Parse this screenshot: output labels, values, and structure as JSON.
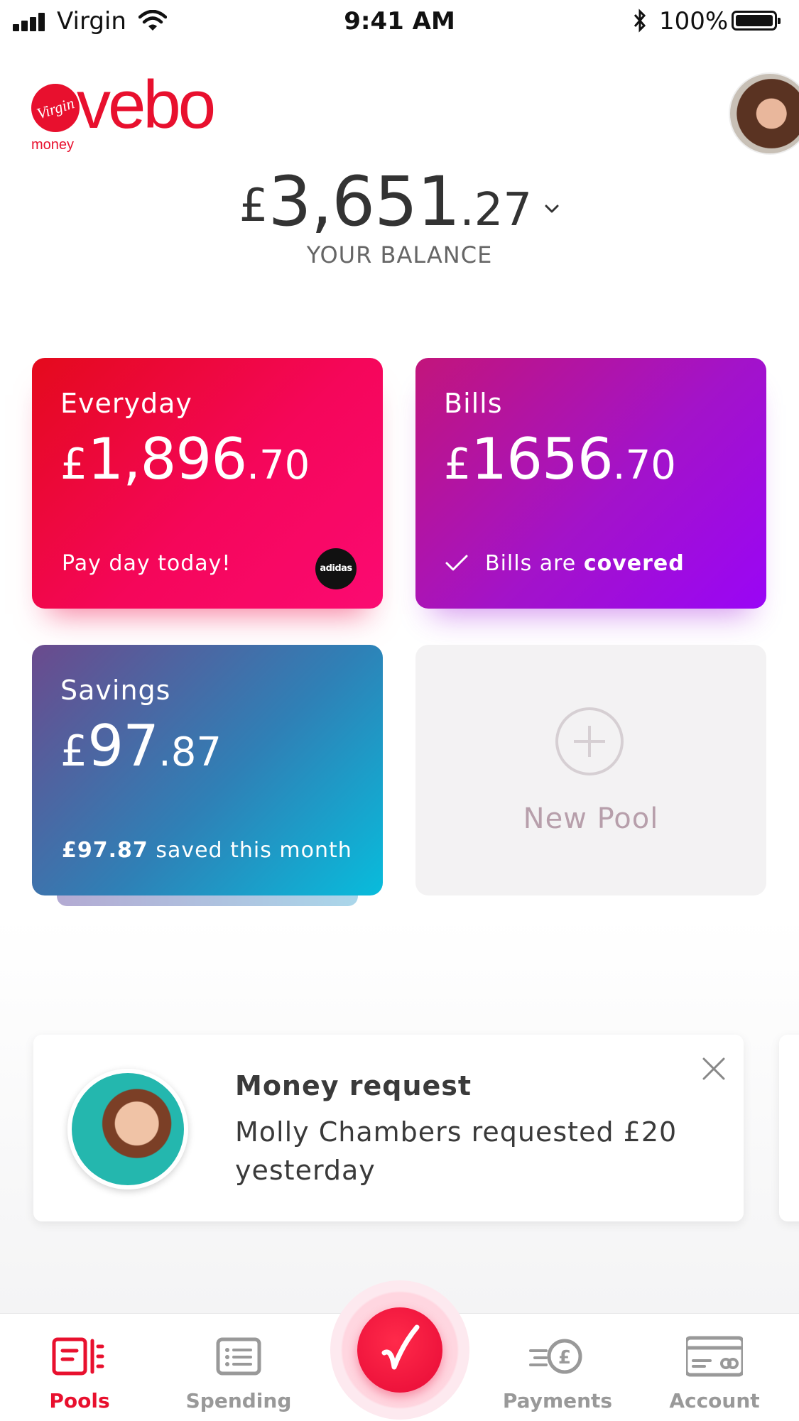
{
  "status_bar": {
    "carrier": "Virgin",
    "time": "9:41 AM",
    "battery": "100%"
  },
  "brand": {
    "badge": "Virgin",
    "name": "vebo",
    "sub": "money",
    "color": "#e8102e"
  },
  "balance": {
    "currency": "£",
    "main": "3,651",
    "pence": ".27",
    "label": "YOUR BALANCE"
  },
  "cards": {
    "everyday": {
      "title": "Everyday",
      "currency": "£",
      "main": "1,896",
      "pence": ".70",
      "footer": "Pay day today!",
      "merchant_badge": "adidas",
      "gradient": [
        "#e40a1c",
        "#fb0a72"
      ]
    },
    "bills": {
      "title": "Bills",
      "currency": "£",
      "main": "1656",
      "pence": ".70",
      "footer_prefix": "Bills are",
      "footer_bold": "covered",
      "gradient": [
        "#c2157b",
        "#9a05f6"
      ]
    },
    "savings": {
      "title": "Savings",
      "currency": "£",
      "main": "97",
      "pence": ".87",
      "footer_bold": "£97.87",
      "footer_suffix": " saved this month",
      "gradient": [
        "#6b4a8d",
        "#08bcdc"
      ]
    },
    "new_pool": {
      "label": "New Pool"
    }
  },
  "money_request": {
    "title": "Money request",
    "body": "Molly Chambers requested £20 yesterday"
  },
  "tabbar": {
    "tabs": [
      {
        "label": "Pools",
        "icon": "pools-icon",
        "active": true
      },
      {
        "label": "Spending",
        "icon": "list-icon",
        "active": false
      },
      {
        "label": "Payments",
        "icon": "payments-icon",
        "active": false
      },
      {
        "label": "Account",
        "icon": "card-icon",
        "active": false
      }
    ],
    "center_icon": "vebo-check-icon",
    "active_color": "#e8102e",
    "inactive_color": "#999999"
  }
}
